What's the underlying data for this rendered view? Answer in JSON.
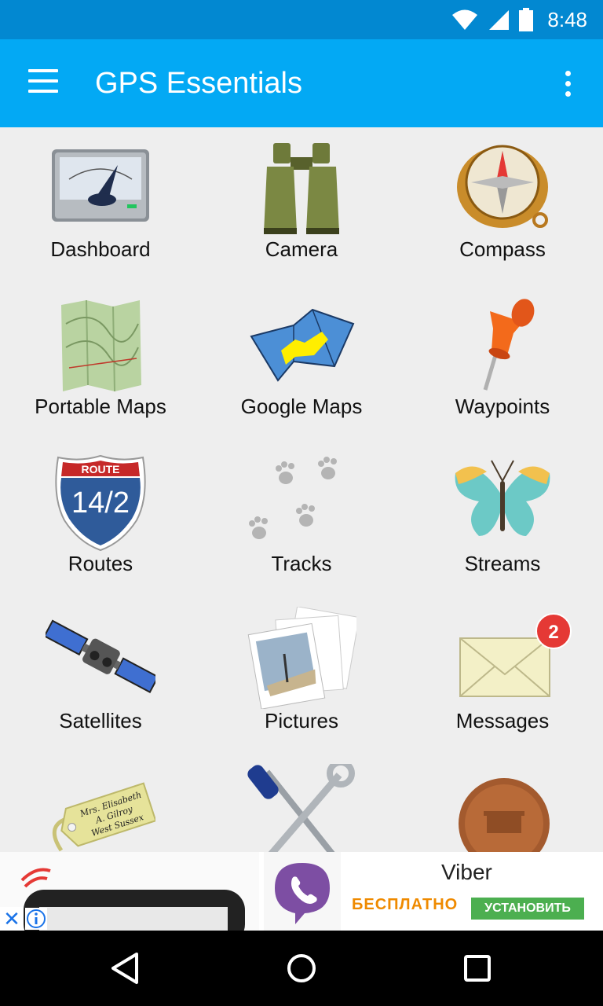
{
  "status_bar": {
    "time": "8:48",
    "icons": [
      "wifi-icon",
      "signal-icon",
      "battery-icon"
    ]
  },
  "app_bar": {
    "title": "GPS Essentials",
    "menu_icon": "hamburger-menu-icon",
    "overflow_icon": "more-vert-icon"
  },
  "grid": {
    "items": [
      {
        "label": "Dashboard",
        "icon": "dashboard-gauge-icon"
      },
      {
        "label": "Camera",
        "icon": "binoculars-icon"
      },
      {
        "label": "Compass",
        "icon": "compass-icon"
      },
      {
        "label": "Portable Maps",
        "icon": "topographic-map-icon"
      },
      {
        "label": "Google Maps",
        "icon": "folded-map-icon"
      },
      {
        "label": "Waypoints",
        "icon": "push-pin-icon"
      },
      {
        "label": "Routes",
        "icon": "route-shield-icon",
        "shield_top": "ROUTE",
        "shield_number": "14/2"
      },
      {
        "label": "Tracks",
        "icon": "paw-tracks-icon"
      },
      {
        "label": "Streams",
        "icon": "butterfly-icon"
      },
      {
        "label": "Satellites",
        "icon": "satellite-icon"
      },
      {
        "label": "Pictures",
        "icon": "photos-icon"
      },
      {
        "label": "Messages",
        "icon": "envelope-icon",
        "badge": "2"
      },
      {
        "label": "",
        "icon": "address-tag-icon",
        "tag_lines": [
          "Mrs. Elisabeth",
          "A. Gilroy",
          "West Sussex"
        ]
      },
      {
        "label": "",
        "icon": "tools-icon"
      },
      {
        "label": "",
        "icon": "penny-coin-icon"
      }
    ]
  },
  "ad": {
    "app_name": "Viber",
    "price": "БЕСПЛАТНО",
    "install": "УСТАНОВИТЬ",
    "close_icon": "close-icon",
    "info_icon": "info-icon",
    "close_glyph": "✕"
  },
  "nav_bar": {
    "buttons": [
      "back-icon",
      "home-icon",
      "recents-icon"
    ]
  },
  "colors": {
    "status_bar": "#0288d1",
    "app_bar": "#03a9f4",
    "badge": "#e53935",
    "install": "#4caf50"
  }
}
